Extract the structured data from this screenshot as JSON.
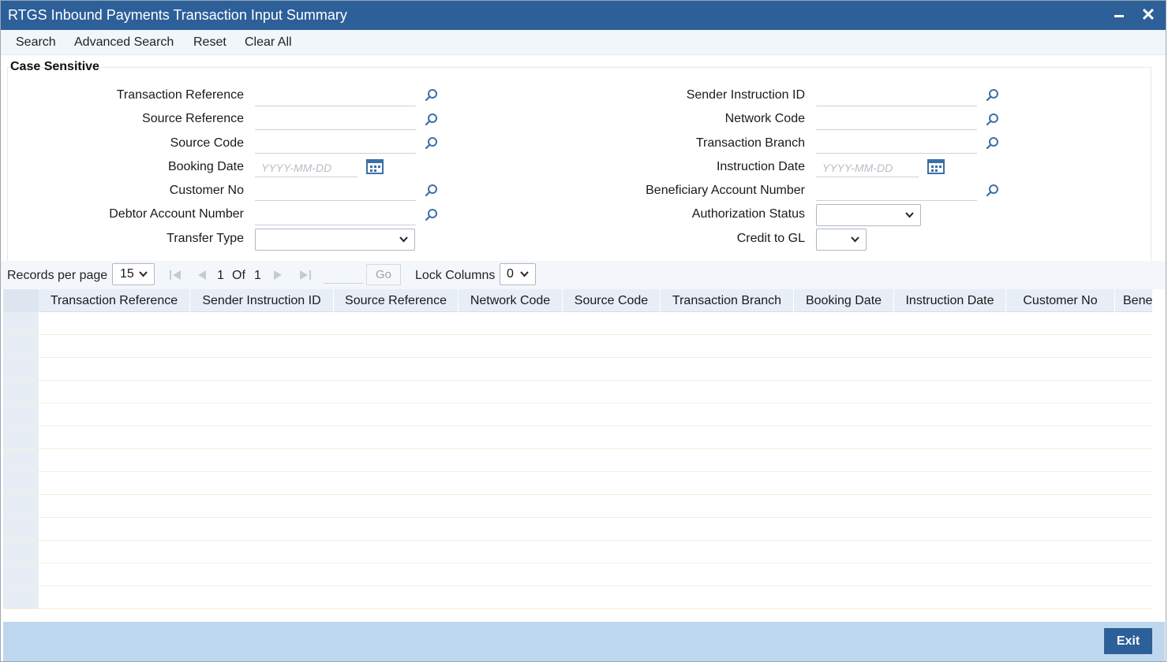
{
  "window": {
    "title": "RTGS Inbound Payments Transaction Input Summary"
  },
  "toolbar": {
    "search": "Search",
    "advanced_search": "Advanced Search",
    "reset": "Reset",
    "clear_all": "Clear All"
  },
  "criteria": {
    "section_title": "Case Sensitive",
    "left": {
      "transaction_reference": "Transaction Reference",
      "source_reference": "Source Reference",
      "source_code": "Source Code",
      "booking_date": "Booking Date",
      "booking_date_placeholder": "YYYY-MM-DD",
      "customer_no": "Customer No",
      "debtor_account_number": "Debtor Account Number",
      "transfer_type": "Transfer Type",
      "transfer_type_value": ""
    },
    "right": {
      "sender_instruction_id": "Sender Instruction ID",
      "network_code": "Network Code",
      "transaction_branch": "Transaction Branch",
      "instruction_date": "Instruction Date",
      "instruction_date_placeholder": "YYYY-MM-DD",
      "beneficiary_account_number": "Beneficiary Account Number",
      "authorization_status": "Authorization Status",
      "authorization_status_value": "",
      "credit_to_gl": "Credit to GL",
      "credit_to_gl_value": ""
    }
  },
  "pager": {
    "records_per_page_label": "Records per page",
    "records_per_page_value": "15",
    "current_page": "1",
    "of_label": "Of",
    "total_pages": "1",
    "go_label": "Go",
    "lock_columns_label": "Lock Columns",
    "lock_columns_value": "0"
  },
  "grid": {
    "columns": [
      "Transaction Reference",
      "Sender Instruction ID",
      "Source Reference",
      "Network Code",
      "Source Code",
      "Transaction Branch",
      "Booking Date",
      "Instruction Date",
      "Customer No",
      "Bene"
    ]
  },
  "footer": {
    "exit_label": "Exit"
  },
  "colors": {
    "titlebar": "#2d5f99",
    "footer": "#bdd7ee",
    "icon_blue": "#3b6fa8"
  },
  "icons": {
    "lov": "search-magnifier-icon",
    "calendar": "calendar-icon",
    "chevron": "chevron-down-icon",
    "first": "first-page-icon",
    "prev": "previous-page-icon",
    "next": "next-page-icon",
    "last": "last-page-icon"
  }
}
